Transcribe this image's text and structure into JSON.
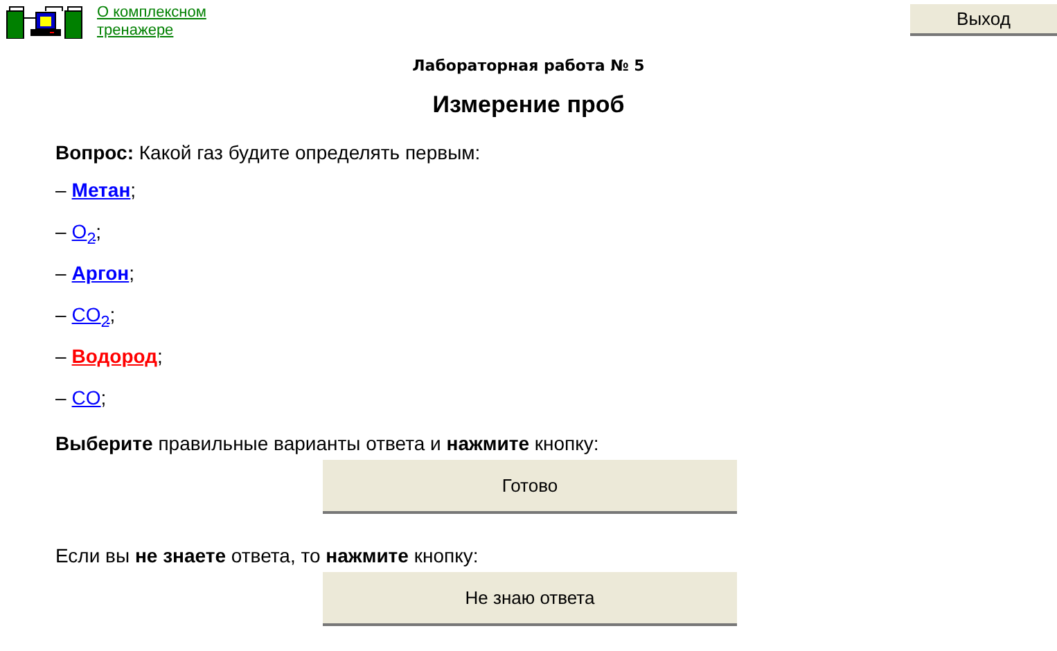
{
  "header": {
    "about_link": "О комплексном тренажере",
    "exit_button": "Выход",
    "lab_title": "Лабораторная работа № 5",
    "heading": "Измерение проб"
  },
  "question": {
    "label": "Вопрос:",
    "text": "Какой газ будите определять первым:"
  },
  "options": [
    {
      "label": "Метан",
      "bold": true,
      "selected": false
    },
    {
      "label": "O$_{2}$",
      "bold": false,
      "selected": false
    },
    {
      "label": "Аргон",
      "bold": true,
      "selected": false
    },
    {
      "label": "CO$_{2}$",
      "bold": false,
      "selected": false
    },
    {
      "label": "Водород",
      "bold": true,
      "selected": true
    },
    {
      "label": "CO",
      "bold": false,
      "selected": false
    }
  ],
  "option_dash": "–",
  "option_sep": ";",
  "instruction": "**Выберите** правильные варианты ответа и **нажмите** кнопку:",
  "done_button": "Готово",
  "dont_know": "Если вы **не знаете** ответа, то **нажмите** кнопку:",
  "dont_know_button": "Не знаю ответа"
}
